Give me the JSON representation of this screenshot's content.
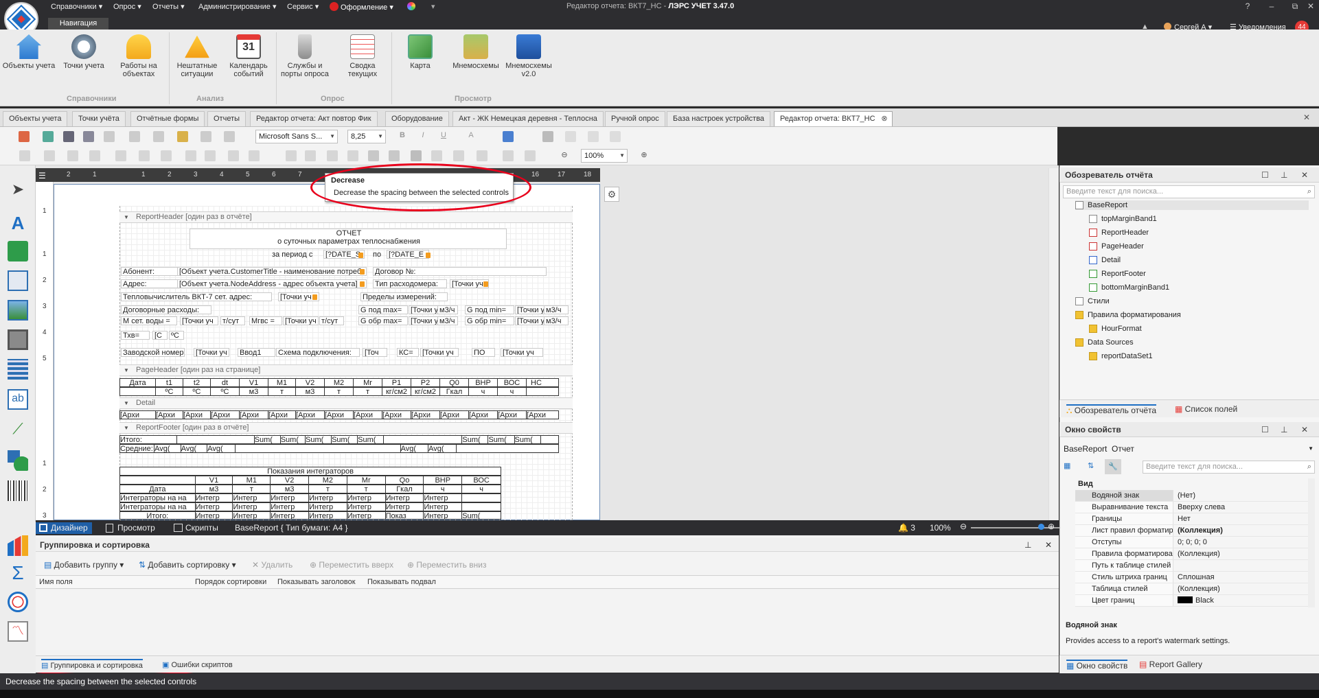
{
  "app": {
    "title_prefix": "Редактор отчета: ВКТ7_НС",
    "title_sep": " - ",
    "title_app": "ЛЭРС УЧЕТ 3.47.0",
    "menu": [
      "Справочники ▾",
      "Опрос ▾",
      "Отчеты ▾",
      "Администрирование ▾",
      "Сервис ▾",
      "Оформление ▾"
    ],
    "user": "Сергей А ▾",
    "notifications_label": "Уведомления",
    "notifications_count": "44"
  },
  "ribbon": {
    "tab": "Навигация",
    "groups": [
      {
        "label": "Справочники",
        "buttons": [
          "Объекты учета",
          "Точки учета",
          "Работы на объектах"
        ]
      },
      {
        "label": "Анализ",
        "buttons": [
          "Нештатные ситуации",
          "Календарь событий"
        ]
      },
      {
        "label": "Опрос",
        "buttons": [
          "Службы и порты опроса",
          "Сводка текущих"
        ]
      },
      {
        "label": "Просмотр",
        "buttons": [
          "Карта",
          "Мнемосхемы",
          "Мнемосхемы v2.0"
        ]
      }
    ]
  },
  "doc_tabs": [
    "Объекты учета",
    "Точки учёта",
    "Отчётные формы",
    "Отчеты",
    "Редактор отчета: Акт повтор Фик",
    "Оборудование",
    "Акт - ЖК Немецкая деревня - Теплосна",
    "Ручной опрос",
    "База настроек устройства",
    "Редактор отчета: ВКТ7_НС"
  ],
  "toolbar": {
    "font": "Microsoft Sans S...",
    "size": "8,25",
    "zoom": "100%"
  },
  "tooltip": {
    "title": "Decrease",
    "desc": "Decrease the spacing between the selected controls"
  },
  "ruler": [
    "2",
    "1",
    "1",
    "2",
    "3",
    "4",
    "5",
    "6",
    "7",
    "16",
    "17",
    "18"
  ],
  "vruler": [
    "1",
    "1",
    "2",
    "3",
    "4",
    "5",
    "1",
    "2",
    "3"
  ],
  "report": {
    "bands": {
      "report_header": "ReportHeader [один раз в отчёте]",
      "page_header": "PageHeader [один раз на странице]",
      "detail": "Detail",
      "report_footer": "ReportFooter [один раз в отчёте]"
    },
    "title1": "ОТЧЕТ",
    "title2": "о суточных параметрах теплоснабжения",
    "period": "за период с",
    "date_s": "[?DATE_S",
    "po": "по",
    "date_e": "[?DATE_E",
    "abonent": "Абонент:",
    "abonent_val": "[Объект учета.CustomerTitle - наименование потреб",
    "dogovor": "Договор №:",
    "adres": "Адрес:",
    "adres_val": "[Объект учета.NodeAddress - адрес объекта учета]",
    "tip": "Тип расходомера:",
    "tochki": "[Точки уч",
    "teplo": "Тепловычислитель ВКТ-7 сет. адрес:",
    "predely": "Пределы измерений:",
    "dog_rash": "Договорные расходы:",
    "gpod_max": "G под max=",
    "gpod_min": "G под min=",
    "m3h": "м3/ч",
    "m_set": "М сет. воды =",
    "tsut": "т/сут",
    "mgvs": "Мгвс =",
    "gobr_max": "G обр max=",
    "gobr_min": "G обр min=",
    "txv": "Тхв=",
    "txv_val": "[С",
    "deg": "ºС",
    "zavod": "Заводской номер:",
    "vvod": "Ввод1",
    "schema": "Схема подключения:",
    "tochk": "[Точ",
    "ks": "КС=",
    "po2": "ПО",
    "table_head": [
      "Дата",
      "t1",
      "t2",
      "dt",
      "V1",
      "M1",
      "V2",
      "M2",
      "Mr",
      "P1",
      "P2",
      "Q0",
      "ВНР",
      "ВОС",
      "НС"
    ],
    "table_units": [
      "",
      "ºС",
      "ºС",
      "ºС",
      "м3",
      "т",
      "м3",
      "т",
      "т",
      "кг/см2",
      "кг/см2",
      "Гкал",
      "ч",
      "ч",
      ""
    ],
    "detail_cell": "[Архи",
    "itogo": "Итого:",
    "srednie": "Средние:",
    "sum": "Sum(",
    "avg": "Avg(",
    "integr_title": "Показания интеграторов",
    "integr_head": [
      "",
      "V1",
      "M1",
      "V2",
      "M2",
      "Mr",
      "Qo",
      "ВНР",
      "ВОС"
    ],
    "integr_units": [
      "Дата",
      "м3",
      "т",
      "м3",
      "т",
      "т",
      "Гкал",
      "ч",
      "ч"
    ],
    "integr_na": "Интеграторы на на",
    "integr_cell": "Интегр",
    "pokaz": "Показ"
  },
  "design_bar": {
    "tabs": [
      "Дизайнер",
      "Просмотр",
      "Скрипты"
    ],
    "info": "BaseReport { Тип бумаги: A4 }",
    "count": "3",
    "zoom": "100%"
  },
  "grouping": {
    "title": "Группировка и сортировка",
    "buttons": [
      "Добавить группу ▾",
      "Добавить сортировку ▾",
      "Удалить",
      "Переместить вверх",
      "Переместить вниз"
    ],
    "columns": [
      "Имя поля",
      "Порядок сортировки",
      "Показывать заголовок",
      "Показывать подвал"
    ],
    "tabs": [
      "Группировка и сортировка",
      "Ошибки скриптов"
    ]
  },
  "status": "Decrease the spacing between the selected controls",
  "explorer": {
    "title": "Обозреватель отчёта",
    "search": "Введите текст для поиска...",
    "nodes": [
      "BaseReport",
      "topMarginBand1",
      "ReportHeader",
      "PageHeader",
      "Detail",
      "ReportFooter",
      "bottomMarginBand1",
      "Стили",
      "Правила форматирования",
      "HourFormat",
      "Data Sources",
      "reportDataSet1"
    ],
    "tabs": [
      "Обозреватель отчёта",
      "Список полей"
    ]
  },
  "props": {
    "title": "Окно свойств",
    "object": "BaseReport",
    "object_type": "Отчет",
    "search": "Введите текст для поиска...",
    "category": "Вид",
    "rows": [
      [
        "Водяной знак",
        "(Нет)"
      ],
      [
        "Выравнивание текста",
        "Вверху слева"
      ],
      [
        "Границы",
        "Нет"
      ],
      [
        "Лист правил форматиро...",
        "(Коллекция)"
      ],
      [
        "Отступы",
        "0; 0; 0; 0"
      ],
      [
        "Правила форматирован...",
        "(Коллекция)"
      ],
      [
        "Путь к таблице стилей",
        ""
      ],
      [
        "Стиль штриха границ",
        "Сплошная"
      ],
      [
        "Таблица стилей",
        "(Коллекция)"
      ],
      [
        "Цвет границ",
        "Black"
      ]
    ],
    "desc_title": "Водяной знак",
    "desc": "Provides access to a report's watermark settings.",
    "tabs": [
      "Окно свойств",
      "Report Gallery"
    ]
  }
}
